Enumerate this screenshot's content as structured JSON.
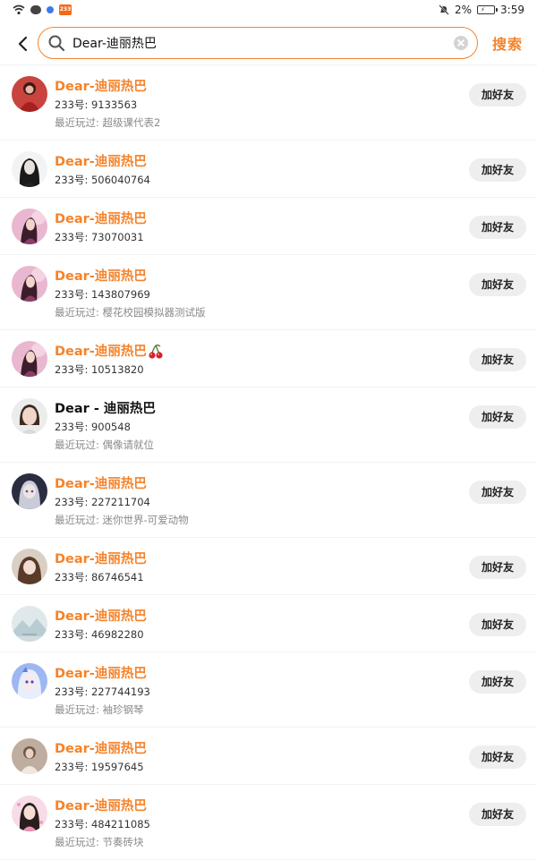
{
  "status_bar": {
    "battery_percent": "2%",
    "time": "3:59",
    "app_badge_text": "233"
  },
  "search": {
    "query": "Dear-迪丽热巴",
    "submit_label": "搜索"
  },
  "colors": {
    "accent": "#f5832a",
    "button_bg": "#eeeeee"
  },
  "results": [
    {
      "name": "Dear-迪丽热巴",
      "uid": "233号: 9133563",
      "recent": "最近玩过: 超级课代表2",
      "add_label": "加好友",
      "avatar": "red"
    },
    {
      "name": "Dear-迪丽热巴",
      "uid": "233号: 506040764",
      "recent": "",
      "add_label": "加好友",
      "avatar": "bw"
    },
    {
      "name": "Dear-迪丽热巴",
      "uid": "233号: 73070031",
      "recent": "",
      "add_label": "加好友",
      "avatar": "pink"
    },
    {
      "name": "Dear-迪丽热巴",
      "uid": "233号: 143807969",
      "recent": "最近玩过: 樱花校园模拟器测试版",
      "add_label": "加好友",
      "avatar": "pink"
    },
    {
      "name": "Dear-迪丽热巴",
      "uid": "233号: 10513820",
      "recent": "",
      "add_label": "加好友",
      "avatar": "pink",
      "emoji": "cherry-icon"
    },
    {
      "name": "Dear - 迪丽热巴",
      "uid": "233号: 900548",
      "recent": "最近玩过: 偶像请就位",
      "add_label": "加好友",
      "avatar": "face",
      "plain": true
    },
    {
      "name": "Dear-迪丽热巴",
      "uid": "233号: 227211704",
      "recent": "最近玩过: 迷你世界-可爱动物",
      "add_label": "加好友",
      "avatar": "anime-dark"
    },
    {
      "name": "Dear-迪丽热巴",
      "uid": "233号: 86746541",
      "recent": "",
      "add_label": "加好友",
      "avatar": "brown"
    },
    {
      "name": "Dear-迪丽热巴",
      "uid": "233号: 46982280",
      "recent": "",
      "add_label": "加好友",
      "avatar": "mountain"
    },
    {
      "name": "Dear-迪丽热巴",
      "uid": "233号: 227744193",
      "recent": "最近玩过: 袖珍钢琴",
      "add_label": "加好友",
      "avatar": "anime-blue"
    },
    {
      "name": "Dear-迪丽热巴",
      "uid": "233号: 19597645",
      "recent": "",
      "add_label": "加好友",
      "avatar": "beige"
    },
    {
      "name": "Dear-迪丽热巴",
      "uid": "233号: 484211085",
      "recent": "最近玩过: 节奏砖块",
      "add_label": "加好友",
      "avatar": "pink-girl"
    }
  ]
}
